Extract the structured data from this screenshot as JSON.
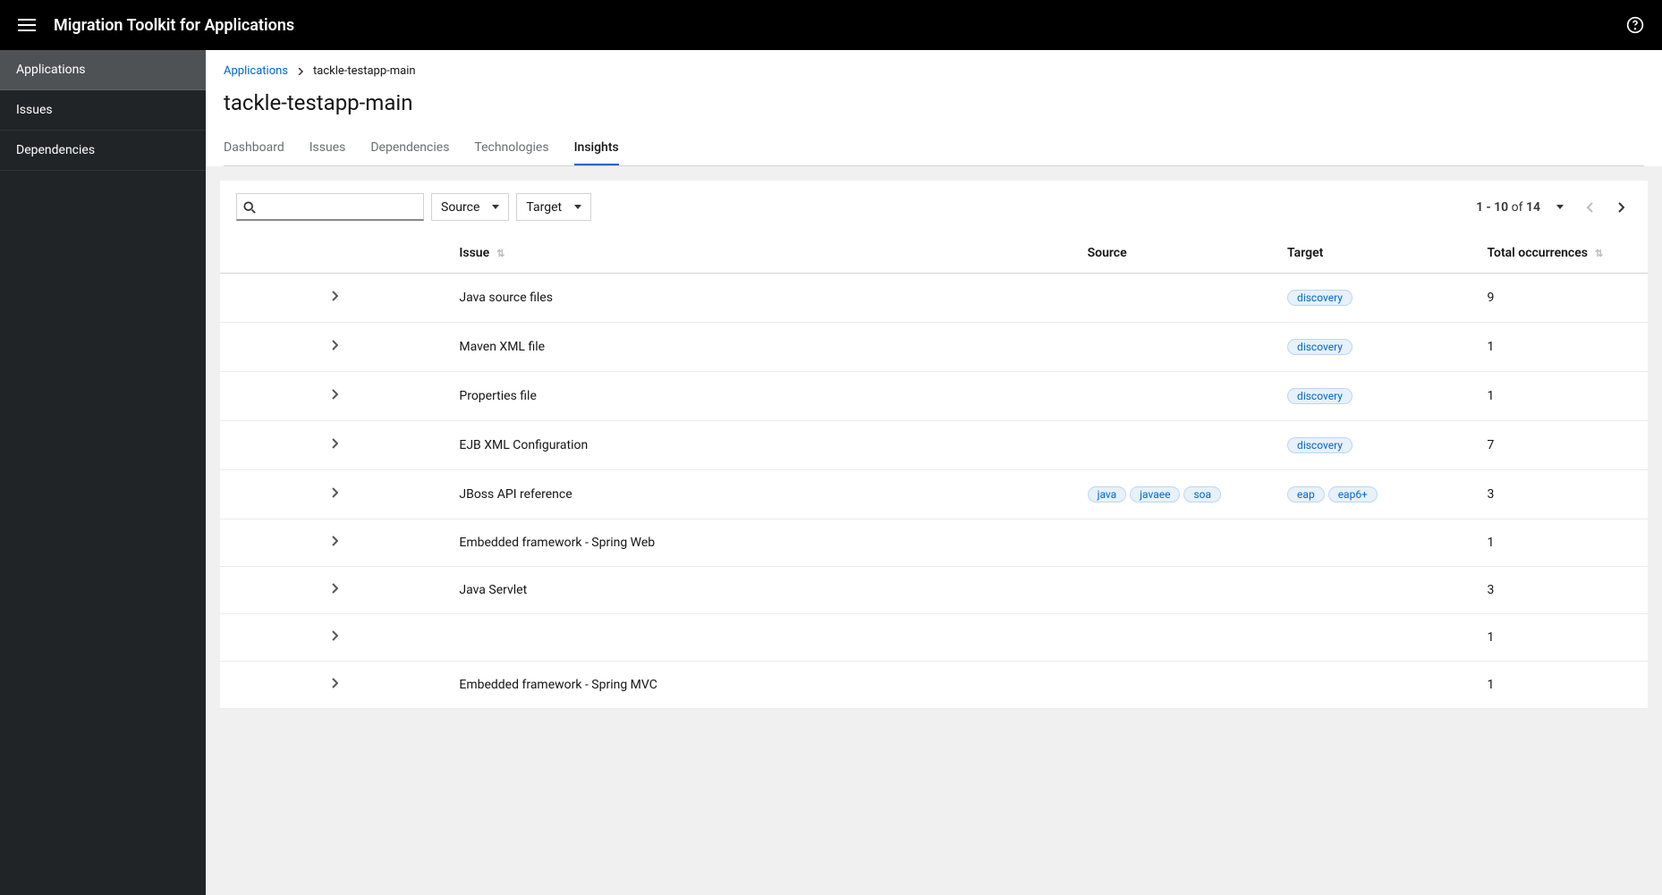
{
  "header": {
    "title": "Migration Toolkit for Applications"
  },
  "sidebar": {
    "items": [
      {
        "label": "Applications",
        "active": true
      },
      {
        "label": "Issues",
        "active": false
      },
      {
        "label": "Dependencies",
        "active": false
      }
    ]
  },
  "breadcrumb": {
    "root": "Applications",
    "current": "tackle-testapp-main"
  },
  "page": {
    "title": "tackle-testapp-main"
  },
  "tabs": [
    {
      "label": "Dashboard",
      "active": false
    },
    {
      "label": "Issues",
      "active": false
    },
    {
      "label": "Dependencies",
      "active": false
    },
    {
      "label": "Technologies",
      "active": false
    },
    {
      "label": "Insights",
      "active": true
    }
  ],
  "toolbar": {
    "filters": [
      {
        "label": "Source"
      },
      {
        "label": "Target"
      }
    ],
    "pagination": {
      "range": "1 - 10",
      "of_label": "of",
      "total": "14"
    }
  },
  "table": {
    "columns": {
      "issue": "Issue",
      "source": "Source",
      "target": "Target",
      "total": "Total occurrences"
    },
    "rows": [
      {
        "issue": "Java source files",
        "source": [],
        "target": [
          "discovery"
        ],
        "total": "9"
      },
      {
        "issue": "Maven XML file",
        "source": [],
        "target": [
          "discovery"
        ],
        "total": "1"
      },
      {
        "issue": "Properties file",
        "source": [],
        "target": [
          "discovery"
        ],
        "total": "1"
      },
      {
        "issue": "EJB XML Configuration",
        "source": [],
        "target": [
          "discovery"
        ],
        "total": "7"
      },
      {
        "issue": "JBoss API reference",
        "source": [
          "java",
          "javaee",
          "soa"
        ],
        "target": [
          "eap",
          "eap6+"
        ],
        "total": "3"
      },
      {
        "issue": "Embedded framework - Spring Web",
        "source": [],
        "target": [],
        "total": "1"
      },
      {
        "issue": "Java Servlet",
        "source": [],
        "target": [],
        "total": "3"
      },
      {
        "issue": "",
        "source": [],
        "target": [],
        "total": "1"
      },
      {
        "issue": "Embedded framework - Spring MVC",
        "source": [],
        "target": [],
        "total": "1"
      }
    ]
  }
}
